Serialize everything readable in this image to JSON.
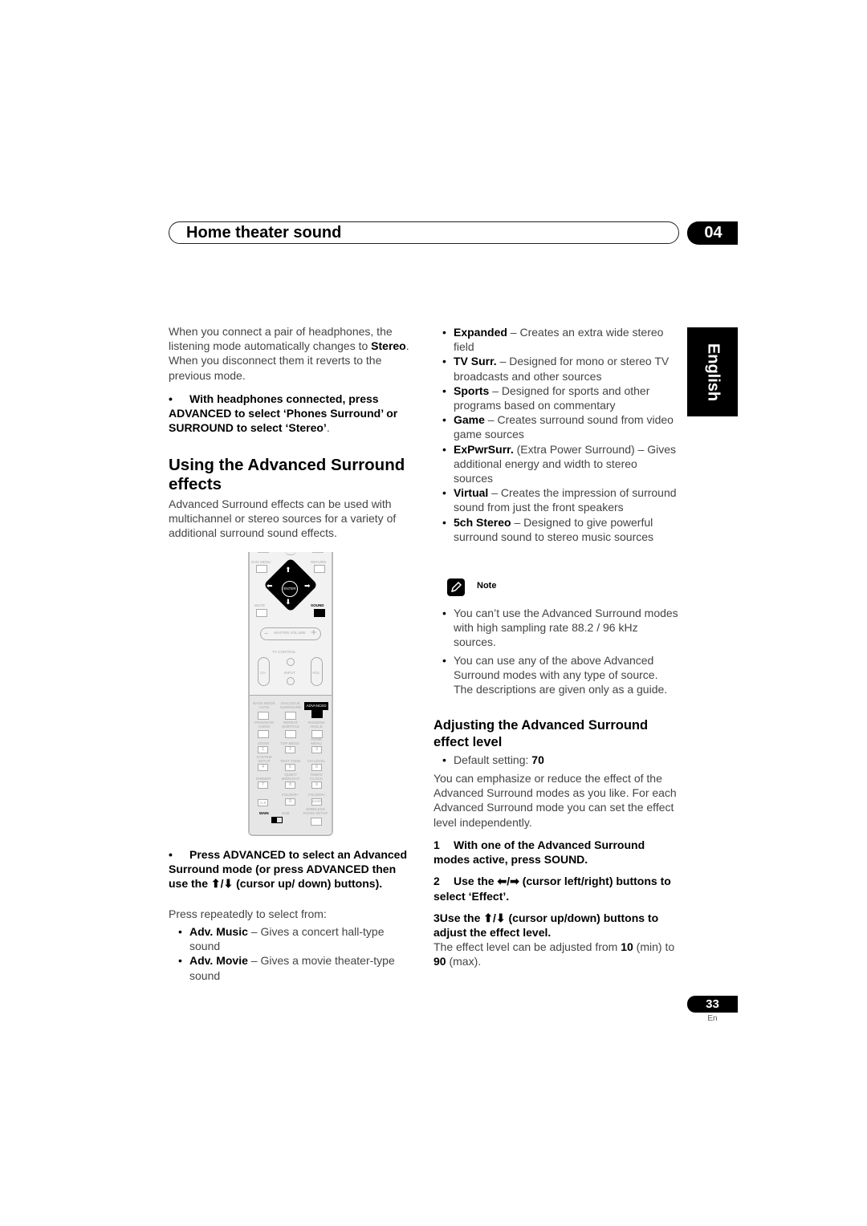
{
  "header": {
    "section_title": "Home theater sound",
    "chapter_number": "04"
  },
  "language_tab": "English",
  "left_column": {
    "intro_text_parts": [
      "When you connect a pair of headphones, the listening mode automatically changes to ",
      "Stereo",
      ". When you disconnect them it reverts to the previous mode."
    ],
    "headphones_instruction": {
      "bullet": "•",
      "text": "With headphones connected, press ADVANCED to select ‘Phones Surround’ or SURROUND to select ‘Stereo’",
      "suffix": "."
    },
    "section_heading": "Using the Advanced Surround effects",
    "section_intro": "Advanced Surround effects can be used with multichannel or stereo sources for a variety of additional surround sound effects.",
    "press_instruction": {
      "bullet": "•",
      "text": "Press ADVANCED to select an Advanced Surround mode (or press ADVANCED then use the ⬆/⬇ (cursor up/ down) buttons)."
    },
    "press_repeatedly": "Press repeatedly to select from:",
    "modes": [
      {
        "name": "Adv. Music",
        "desc": " – Gives a concert hall-type sound"
      },
      {
        "name": "Adv. Movie",
        "desc": " – Gives a movie theater-type sound"
      }
    ]
  },
  "right_column": {
    "modes": [
      {
        "name": "Expanded",
        "desc": " – Creates an extra wide stereo field"
      },
      {
        "name": "TV Surr.",
        "desc": " – Designed for mono or stereo TV broadcasts and other sources"
      },
      {
        "name": "Sports",
        "desc": " – Designed for sports and other programs based on commentary"
      },
      {
        "name": "Game",
        "desc": " – Creates surround sound from video game sources"
      },
      {
        "name": "ExPwrSurr.",
        "desc": " (Extra Power Surround) – Gives additional energy and width to stereo sources"
      },
      {
        "name": "Virtual",
        "desc": " – Creates the impression of surround sound from just the front speakers"
      },
      {
        "name": "5ch Stereo",
        "desc": " – Designed to give powerful surround sound to stereo music sources"
      }
    ],
    "note": {
      "label": "Note",
      "icon": "pencil-icon",
      "items": [
        "You can’t use the Advanced Surround modes with high sampling rate 88.2 / 96 kHz sources.",
        "You can use any of the above Advanced Surround modes with any type of source. The descriptions are given only as a guide."
      ]
    },
    "adjust_heading": "Adjusting the Advanced Surround effect level",
    "default_setting_label": "Default setting: ",
    "default_setting_value": "70",
    "adjust_intro": "You can emphasize or reduce the effect of the Advanced Surround modes as you like. For each Advanced Surround mode you can set the effect level independently.",
    "steps": [
      {
        "num": "1",
        "text": "With one of the Advanced Surround modes active, press SOUND."
      },
      {
        "num": "2",
        "text": "Use the ⬅/➡ (cursor left/right) buttons to select ‘Effect’."
      },
      {
        "num": "3",
        "text": "Use the ⬆/⬇ (cursor up/down) buttons to adjust the effect level."
      }
    ],
    "range_text": {
      "prefix": "The effect level can be adjusted from ",
      "min": "10",
      "min_suffix": " (min) to ",
      "max": "90",
      "max_suffix": " (max)."
    }
  },
  "remote": {
    "dvd_menu": "DVD MENU",
    "return": "RETURN",
    "enter": "ENTER",
    "mute": "MUTE",
    "sound": "SOUND",
    "master_volume": "MASTER VOLUME",
    "tv_control": "TV CONTROL",
    "ch": "CH",
    "input": "INPUT",
    "vol": "VOL",
    "bass_mode": "BASS MODE AUTO",
    "dialogue": "DIALOGUE SURROUND",
    "advanced": "ADVANCED",
    "program": "PROGRAM AUDIO",
    "repeat": "REPEAT SUBTITLE",
    "random": "RANDOM ANGLE",
    "zoom": "ZOOM",
    "top_menu": "TOP MENU",
    "home_menu": "HOME MENU",
    "system_setup": "SYSTEM SETUP",
    "test_tone": "TEST TONE",
    "ch_level": "CH LEVEL",
    "dimmer": "DIMMER",
    "quiet": "QUIET/ MIDNIGHT",
    "timer": "TIMER/ CLOCK",
    "folder_minus": "FOLDER–",
    "folder_plus": "FOLDER+",
    "clr": "CLR",
    "enter_small": "ENTER",
    "main": "MAIN",
    "sub": "SUB",
    "wireless": "WIRELESS ROOM SETUP",
    "digits": [
      "1",
      "2",
      "3",
      "4",
      "5",
      "6",
      "7",
      "8",
      "9",
      "0"
    ]
  },
  "footer": {
    "page_number": "33",
    "page_lang": "En"
  }
}
